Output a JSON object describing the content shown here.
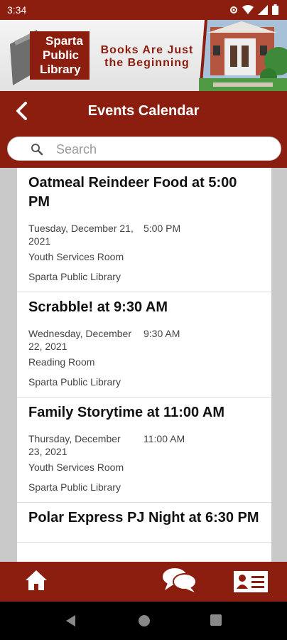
{
  "status_bar": {
    "time": "3:34"
  },
  "banner": {
    "logo_text": "Sparta Public Library",
    "tagline_line1": "Books Are Just",
    "tagline_line2": "the Beginning"
  },
  "header": {
    "title": "Events Calendar"
  },
  "search": {
    "placeholder": "Search",
    "value": ""
  },
  "events": [
    {
      "title": "Oatmeal Reindeer Food at 5:00 PM",
      "date": "Tuesday, December 21, 2021",
      "time": "5:00 PM",
      "room": "Youth Services Room",
      "library": "Sparta Public Library"
    },
    {
      "title": "Scrabble! at 9:30 AM",
      "date": "Wednesday, December 22, 2021",
      "time": "9:30 AM",
      "room": "Reading Room",
      "library": "Sparta Public Library"
    },
    {
      "title": "Family Storytime at 11:00 AM",
      "date": "Thursday, December 23, 2021",
      "time": "11:00 AM",
      "room": "Youth Services Room",
      "library": "Sparta Public Library"
    },
    {
      "title": "Polar Express PJ Night at 6:30 PM",
      "date": "",
      "time": "",
      "room": "",
      "library": ""
    }
  ],
  "bottom_nav": [
    "home-icon",
    "chat-icon",
    "contact-card-icon"
  ],
  "colors": {
    "brand": "#8b1e0f",
    "background": "#c9c9c9"
  }
}
